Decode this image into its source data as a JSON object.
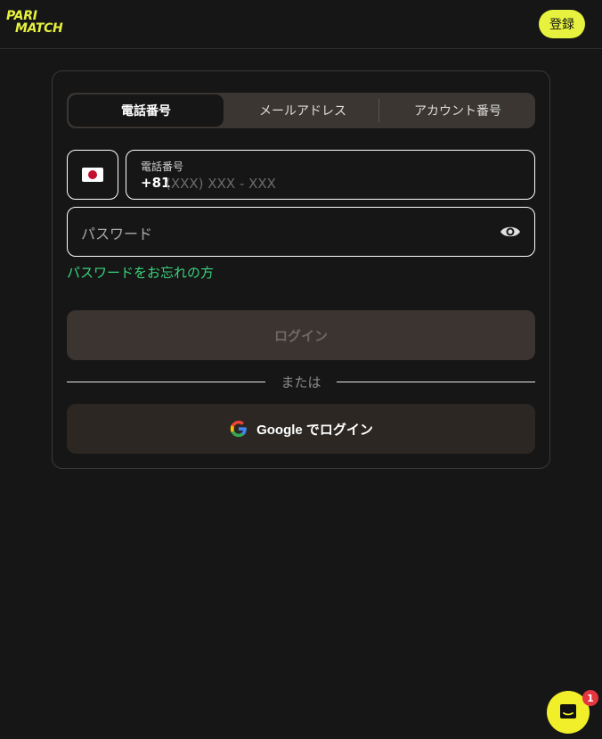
{
  "header": {
    "logo_line1": "PARI",
    "logo_line2": "MATCH",
    "register_label": "登録"
  },
  "tabs": [
    {
      "label": "電話番号",
      "active": true
    },
    {
      "label": "メールアドレス",
      "active": false
    },
    {
      "label": "アカウント番号",
      "active": false
    }
  ],
  "phone": {
    "flag_icon": "japan-flag-icon",
    "label": "電話番号",
    "country_code": "+81",
    "placeholder": "(XXX) XXX - XXX"
  },
  "password": {
    "placeholder": "パスワード",
    "icon": "eye-icon"
  },
  "forgot_label": "パスワードをお忘れの方",
  "login_label": "ログイン",
  "divider_label": "または",
  "google": {
    "icon": "google-icon",
    "label": "Google でログイン"
  },
  "chat": {
    "icon": "chat-icon",
    "badge": "1"
  },
  "colors": {
    "accent": "#e6f23d",
    "link": "#39d37c",
    "background": "#161616"
  }
}
